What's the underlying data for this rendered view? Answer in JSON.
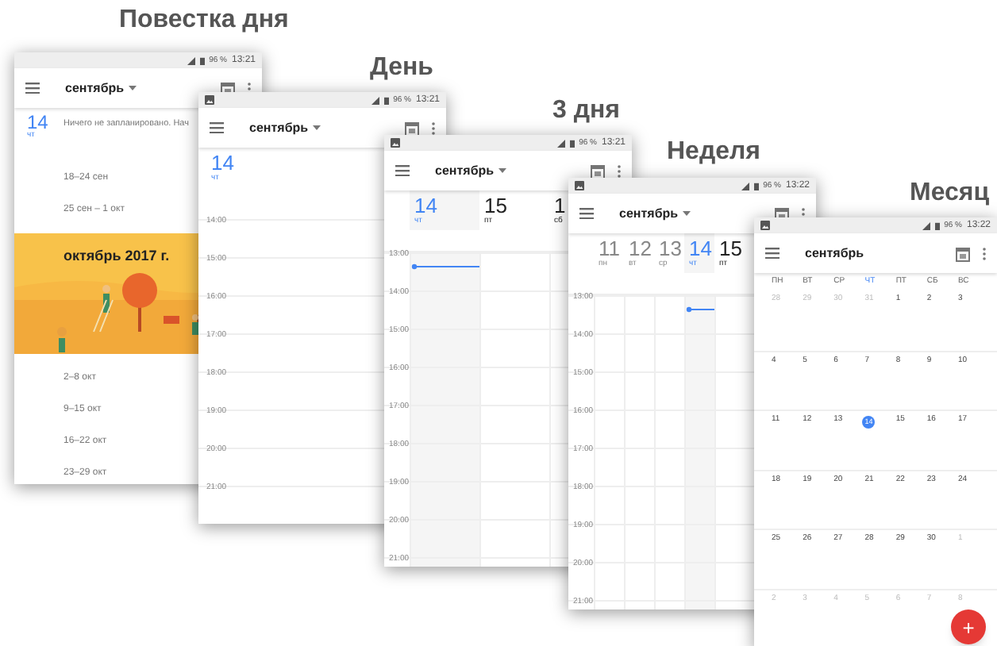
{
  "phones": [
    {
      "kind": "agenda",
      "title": "Повестка дня",
      "status": {
        "notification_icon": false,
        "battery": "96 %",
        "time": "13:21"
      },
      "toolbar": {
        "month": "сентябрь",
        "dropdown": true
      },
      "today": {
        "day": "14",
        "weekday": "чт"
      },
      "empty_message": "Ничего не запланировано. Нач",
      "items": [
        {
          "kind": "week",
          "label": "18–24 сен"
        },
        {
          "kind": "week",
          "label": "25 сен – 1 окт"
        },
        {
          "kind": "banner",
          "label": "октябрь 2017 г."
        },
        {
          "kind": "week",
          "label": "2–8 окт"
        },
        {
          "kind": "week",
          "label": "9–15 окт"
        },
        {
          "kind": "week",
          "label": "16–22 окт"
        },
        {
          "kind": "week",
          "label": "23–29 окт"
        }
      ]
    },
    {
      "kind": "day",
      "title": "День",
      "status": {
        "notification_icon": true,
        "battery": "96 %",
        "time": "13:21"
      },
      "toolbar": {
        "month": "сентябрь",
        "dropdown": true
      },
      "days": [
        {
          "day": "14",
          "weekday": "чт",
          "selected": true
        }
      ],
      "hours": [
        "14:00",
        "15:00",
        "16:00",
        "17:00",
        "18:00",
        "19:00",
        "20:00",
        "21:00"
      ]
    },
    {
      "kind": "multi",
      "title": "3 дня",
      "status": {
        "notification_icon": true,
        "battery": "96 %",
        "time": "13:21"
      },
      "toolbar": {
        "month": "сентябрь",
        "dropdown": true
      },
      "now_indicator": true,
      "days": [
        {
          "day": "14",
          "weekday": "чт",
          "selected": true
        },
        {
          "day": "15",
          "weekday": "пт",
          "selected": false,
          "past": false
        },
        {
          "day": "1",
          "weekday": "сб",
          "selected": false,
          "past": false
        }
      ],
      "hours": [
        "13:00",
        "14:00",
        "15:00",
        "16:00",
        "17:00",
        "18:00",
        "19:00",
        "20:00",
        "21:00"
      ]
    },
    {
      "kind": "multi",
      "title": "Неделя",
      "status": {
        "notification_icon": true,
        "battery": "96 %",
        "time": "13:22"
      },
      "toolbar": {
        "month": "сентябрь",
        "dropdown": true
      },
      "now_indicator": true,
      "days": [
        {
          "day": "11",
          "weekday": "пн",
          "selected": false,
          "past": true
        },
        {
          "day": "12",
          "weekday": "вт",
          "selected": false,
          "past": true
        },
        {
          "day": "13",
          "weekday": "ср",
          "selected": false,
          "past": true
        },
        {
          "day": "14",
          "weekday": "чт",
          "selected": true
        },
        {
          "day": "15",
          "weekday": "пт",
          "selected": false,
          "past": false
        }
      ],
      "hours": [
        "13:00",
        "14:00",
        "15:00",
        "16:00",
        "17:00",
        "18:00",
        "19:00",
        "20:00",
        "21:00"
      ]
    },
    {
      "kind": "month",
      "title": "Месяц",
      "status": {
        "notification_icon": true,
        "battery": "96 %",
        "time": "13:22"
      },
      "toolbar": {
        "month": "сентябрь",
        "dropdown": false
      },
      "weekdays": [
        {
          "label": "ПН",
          "selected": false
        },
        {
          "label": "ВТ",
          "selected": false
        },
        {
          "label": "СР",
          "selected": false
        },
        {
          "label": "ЧТ",
          "selected": true
        },
        {
          "label": "ПТ",
          "selected": false
        },
        {
          "label": "СБ",
          "selected": false
        },
        {
          "label": "ВС",
          "selected": false
        }
      ],
      "weeks": [
        [
          {
            "day": "28",
            "muted": true,
            "today": false
          },
          {
            "day": "29",
            "muted": true,
            "today": false
          },
          {
            "day": "30",
            "muted": true,
            "today": false
          },
          {
            "day": "31",
            "muted": true,
            "today": false
          },
          {
            "day": "1",
            "muted": false,
            "today": false
          },
          {
            "day": "2",
            "muted": false,
            "today": false
          },
          {
            "day": "3",
            "muted": false,
            "today": false
          }
        ],
        [
          {
            "day": "4",
            "muted": false,
            "today": false
          },
          {
            "day": "5",
            "muted": false,
            "today": false
          },
          {
            "day": "6",
            "muted": false,
            "today": false
          },
          {
            "day": "7",
            "muted": false,
            "today": false
          },
          {
            "day": "8",
            "muted": false,
            "today": false
          },
          {
            "day": "9",
            "muted": false,
            "today": false
          },
          {
            "day": "10",
            "muted": false,
            "today": false
          }
        ],
        [
          {
            "day": "11",
            "muted": false,
            "today": false
          },
          {
            "day": "12",
            "muted": false,
            "today": false
          },
          {
            "day": "13",
            "muted": false,
            "today": false
          },
          {
            "day": "14",
            "muted": false,
            "today": true
          },
          {
            "day": "15",
            "muted": false,
            "today": false
          },
          {
            "day": "16",
            "muted": false,
            "today": false
          },
          {
            "day": "17",
            "muted": false,
            "today": false
          }
        ],
        [
          {
            "day": "18",
            "muted": false,
            "today": false
          },
          {
            "day": "19",
            "muted": false,
            "today": false
          },
          {
            "day": "20",
            "muted": false,
            "today": false
          },
          {
            "day": "21",
            "muted": false,
            "today": false
          },
          {
            "day": "22",
            "muted": false,
            "today": false
          },
          {
            "day": "23",
            "muted": false,
            "today": false
          },
          {
            "day": "24",
            "muted": false,
            "today": false
          }
        ],
        [
          {
            "day": "25",
            "muted": false,
            "today": false
          },
          {
            "day": "26",
            "muted": false,
            "today": false
          },
          {
            "day": "27",
            "muted": false,
            "today": false
          },
          {
            "day": "28",
            "muted": false,
            "today": false
          },
          {
            "day": "29",
            "muted": false,
            "today": false
          },
          {
            "day": "30",
            "muted": false,
            "today": false
          },
          {
            "day": "1",
            "muted": true,
            "today": false
          }
        ],
        [
          {
            "day": "2",
            "muted": true,
            "today": false
          },
          {
            "day": "3",
            "muted": true,
            "today": false
          },
          {
            "day": "4",
            "muted": true,
            "today": false
          },
          {
            "day": "5",
            "muted": true,
            "today": false
          },
          {
            "day": "6",
            "muted": true,
            "today": false
          },
          {
            "day": "7",
            "muted": true,
            "today": false
          },
          {
            "day": "8",
            "muted": true,
            "today": false
          }
        ]
      ],
      "fab": {
        "label": "+"
      }
    }
  ]
}
